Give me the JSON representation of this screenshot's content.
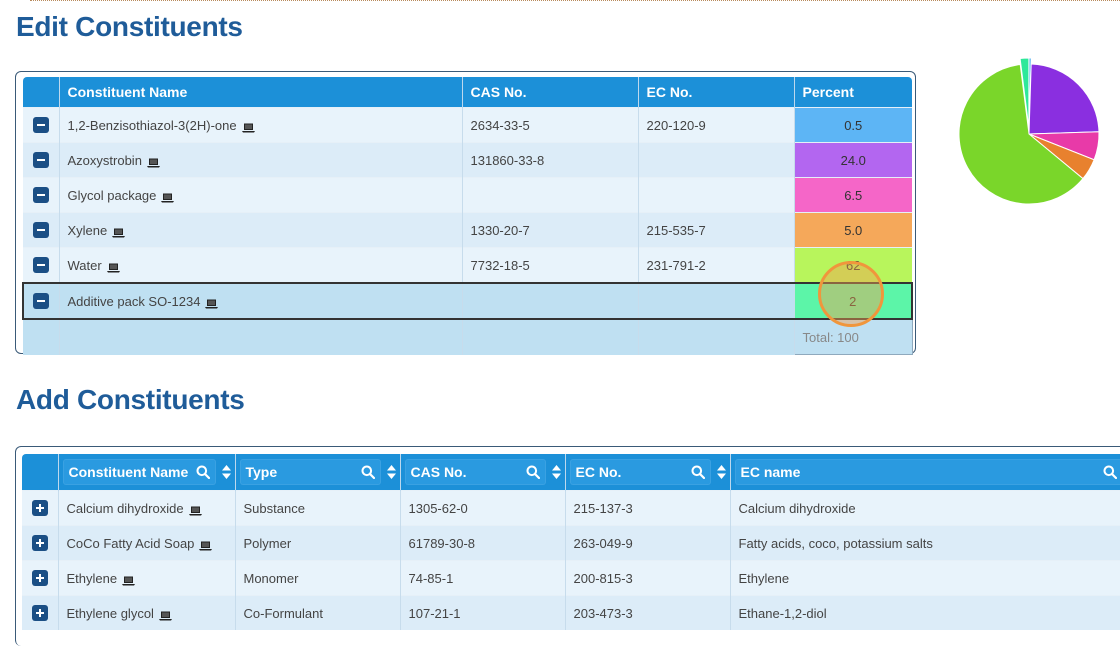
{
  "edit_section": {
    "title": "Edit Constituents",
    "columns": [
      "Constituent Name",
      "CAS No.",
      "EC No.",
      "Percent"
    ],
    "rows": [
      {
        "name": "1,2-Benzisothiazol-3(2H)-one",
        "cas": "2634-33-5",
        "ec": "220-120-9",
        "percent": "0.5",
        "color": "#5db5f5"
      },
      {
        "name": "Azoxystrobin",
        "cas": "131860-33-8",
        "ec": "",
        "percent": "24.0",
        "color": "#b366f0"
      },
      {
        "name": "Glycol package",
        "cas": "",
        "ec": "",
        "percent": "6.5",
        "color": "#f566c8"
      },
      {
        "name": "Xylene",
        "cas": "1330-20-7",
        "ec": "215-535-7",
        "percent": "5.0",
        "color": "#f5a85a"
      },
      {
        "name": "Water",
        "cas": "7732-18-5",
        "ec": "231-791-2",
        "percent": "62",
        "color": "#b8f55c"
      },
      {
        "name": "Additive pack SO-1234",
        "cas": "",
        "ec": "",
        "percent": "2",
        "color": "#5cf5a8"
      }
    ],
    "total_label": "Total: 100"
  },
  "pie_chart": {
    "slices": [
      {
        "label": "1,2-Benzisothiazol-3(2H)-one",
        "value": 0.5,
        "color": "#3fa8f0"
      },
      {
        "label": "Azoxystrobin",
        "value": 24.0,
        "color": "#8a2fe0"
      },
      {
        "label": "Glycol package",
        "value": 6.5,
        "color": "#e83aa8"
      },
      {
        "label": "Xylene",
        "value": 5.0,
        "color": "#e8812e"
      },
      {
        "label": "Water",
        "value": 62,
        "color": "#7ad62a"
      },
      {
        "label": "Additive pack SO-1234",
        "value": 2,
        "color": "#2ee89a"
      }
    ]
  },
  "add_section": {
    "title": "Add Constituents",
    "columns": [
      "Constituent Name",
      "Type",
      "CAS No.",
      "EC No.",
      "EC name"
    ],
    "rows": [
      {
        "name": "Calcium dihydroxide",
        "type": "Substance",
        "cas": "1305-62-0",
        "ec": "215-137-3",
        "ec_name": "Calcium dihydroxide"
      },
      {
        "name": "CoCo Fatty Acid Soap",
        "type": "Polymer",
        "cas": "61789-30-8",
        "ec": "263-049-9",
        "ec_name": "Fatty acids, coco, potassium salts"
      },
      {
        "name": "Ethylene",
        "type": "Monomer",
        "cas": "74-85-1",
        "ec": "200-815-3",
        "ec_name": "Ethylene"
      },
      {
        "name": "Ethylene glycol",
        "type": "Co-Formulant",
        "cas": "107-21-1",
        "ec": "203-473-3",
        "ec_name": "Ethane-1,2-diol"
      }
    ]
  }
}
